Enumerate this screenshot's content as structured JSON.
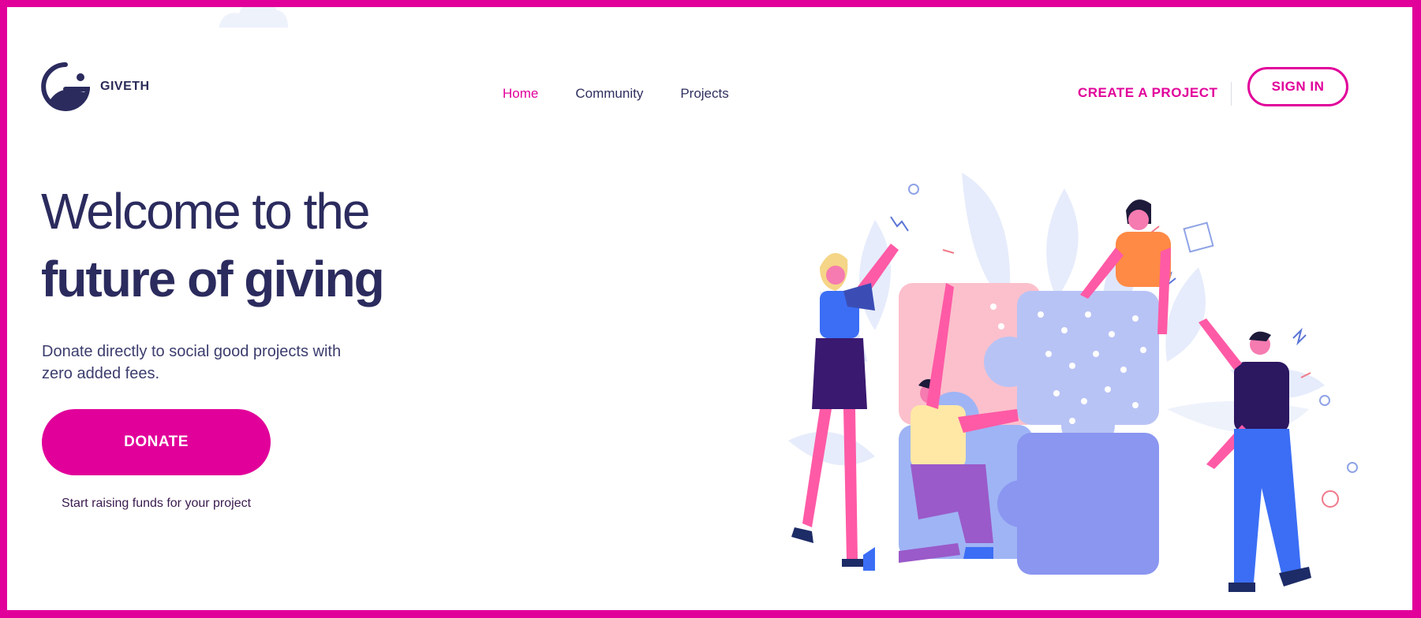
{
  "header": {
    "brand": "GIVETH",
    "nav": [
      {
        "label": "Home",
        "active": true
      },
      {
        "label": "Community",
        "active": false
      },
      {
        "label": "Projects",
        "active": false
      }
    ],
    "create_project_label": "CREATE A PROJECT",
    "sign_in_label": "SIGN IN"
  },
  "hero": {
    "title_line1": "Welcome to the",
    "title_line2": "future of giving",
    "subtitle": "Donate directly to social good projects with zero added fees.",
    "donate_label": "DONATE",
    "raise_funds_label": "Start raising funds for your project"
  },
  "colors": {
    "brand_pink": "#e1009a",
    "navy": "#2b2b5e"
  },
  "icons": {
    "logo": "giveth-logo-icon",
    "illustration": "people-solving-puzzle-illustration"
  }
}
